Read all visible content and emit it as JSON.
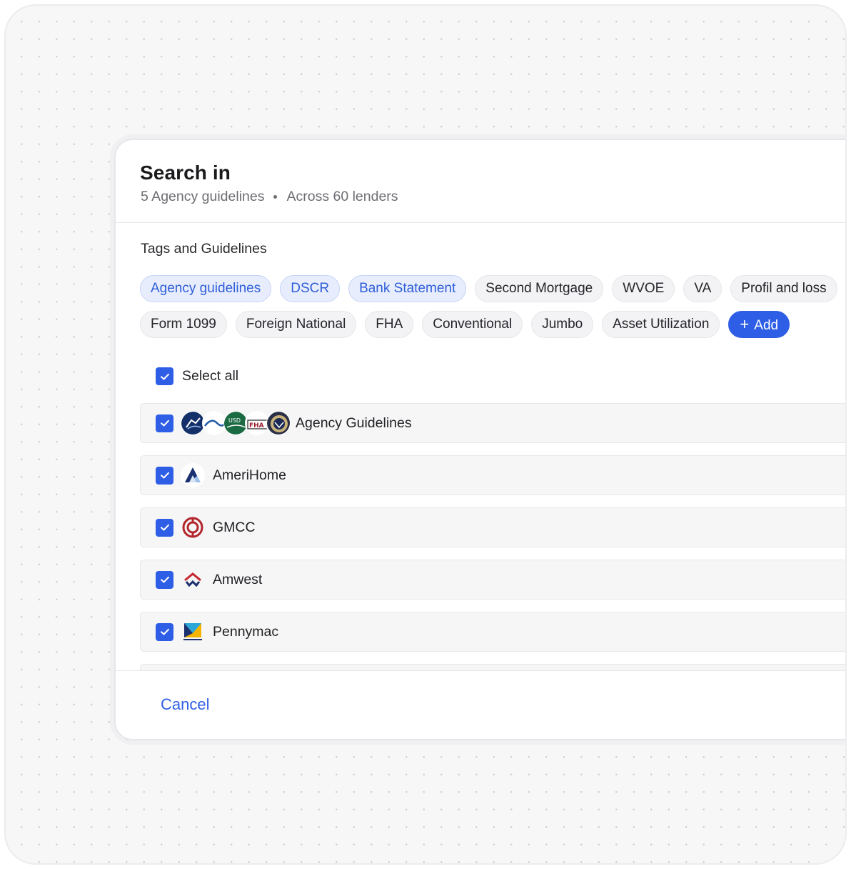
{
  "dialog": {
    "title": "Search in",
    "subtitle": {
      "guidelines": "5 Agency guidelines",
      "lenders": "Across 60 lenders"
    },
    "section_label": "Tags and Guidelines",
    "tags_row1": [
      {
        "label": "Agency guidelines",
        "active": true
      },
      {
        "label": "DSCR",
        "active": true
      },
      {
        "label": "Bank Statement",
        "active": true
      },
      {
        "label": "Second Mortgage",
        "active": false
      },
      {
        "label": "WVOE",
        "active": false
      },
      {
        "label": "VA",
        "active": false
      },
      {
        "label": "Profil and loss",
        "active": false
      }
    ],
    "tags_row2": [
      {
        "label": "Form 1099",
        "active": false
      },
      {
        "label": "Foreign National",
        "active": false
      },
      {
        "label": "FHA",
        "active": false
      },
      {
        "label": "Conventional",
        "active": false
      },
      {
        "label": "Jumbo",
        "active": false
      },
      {
        "label": "Asset Utilization",
        "active": false
      }
    ],
    "add_tag_label": "Add",
    "select_all_label": "Select all",
    "lenders": [
      {
        "name": "Agency Guidelines",
        "checked": true,
        "icon": "agency-logos"
      },
      {
        "name": "AmeriHome",
        "checked": true,
        "icon": "amerihome-logo"
      },
      {
        "name": "GMCC",
        "checked": true,
        "icon": "gmcc-logo"
      },
      {
        "name": "Amwest",
        "checked": true,
        "icon": "amwest-logo"
      },
      {
        "name": "Pennymac",
        "checked": true,
        "icon": "pennymac-logo"
      }
    ],
    "cancel_label": "Cancel"
  },
  "colors": {
    "accent": "#2f5ee6",
    "active_tag_bg": "#e7edfc",
    "active_tag_text": "#2f5ed8"
  }
}
